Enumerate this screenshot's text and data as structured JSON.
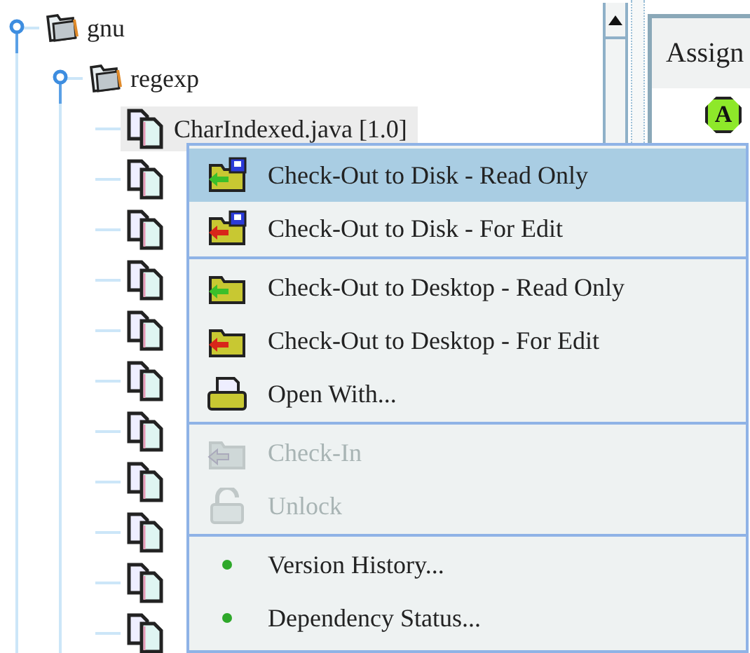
{
  "tree": [
    {
      "kind": "folder",
      "label": "gnu",
      "expanded": true,
      "children": [
        {
          "kind": "folder",
          "label": "regexp",
          "expanded": true,
          "children": [
            {
              "kind": "file",
              "label": "CharIndexed.java [1.0]",
              "selected": true
            },
            {
              "kind": "file",
              "selected": false
            },
            {
              "kind": "file",
              "selected": false
            },
            {
              "kind": "file",
              "selected": false
            },
            {
              "kind": "file",
              "selected": false
            },
            {
              "kind": "file",
              "selected": false
            },
            {
              "kind": "file",
              "selected": false
            },
            {
              "kind": "file",
              "selected": false
            },
            {
              "kind": "file",
              "selected": false
            },
            {
              "kind": "file",
              "selected": false
            },
            {
              "kind": "file",
              "selected": false
            }
          ]
        }
      ]
    }
  ],
  "right_panel": {
    "header": "Assign",
    "badge": "A"
  },
  "context_menu": [
    {
      "kind": "icon",
      "label": "Check-Out to Disk - Read Only",
      "selected": true,
      "disabled": false
    },
    {
      "kind": "icon",
      "label": "Check-Out to Disk - For Edit",
      "selected": false,
      "disabled": false
    },
    {
      "kind": "separator"
    },
    {
      "kind": "icon",
      "label": "Check-Out to Desktop - Read Only",
      "selected": false,
      "disabled": false
    },
    {
      "kind": "icon",
      "label": "Check-Out to Desktop - For Edit",
      "selected": false,
      "disabled": false
    },
    {
      "kind": "icon",
      "label": "Open With...",
      "selected": false,
      "disabled": false
    },
    {
      "kind": "separator"
    },
    {
      "kind": "icon",
      "label": "Check-In",
      "selected": false,
      "disabled": true
    },
    {
      "kind": "icon",
      "label": "Unlock",
      "selected": false,
      "disabled": true
    },
    {
      "kind": "separator"
    },
    {
      "kind": "bullet",
      "label": "Version History...",
      "selected": false,
      "disabled": false
    },
    {
      "kind": "bullet",
      "label": "Dependency Status...",
      "selected": false,
      "disabled": false
    }
  ]
}
